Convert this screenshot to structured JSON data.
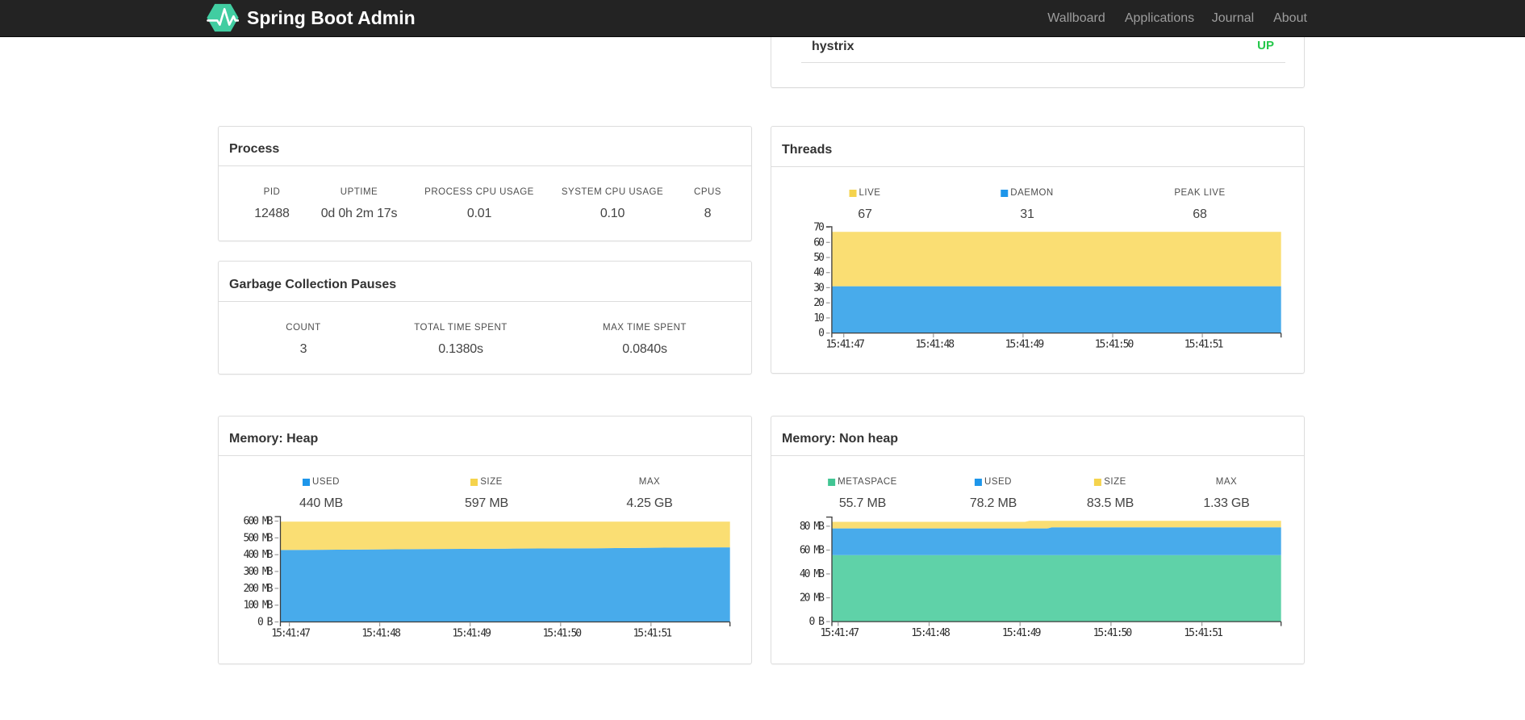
{
  "navbar": {
    "brand": "Spring Boot Admin",
    "items": [
      {
        "label": "Wallboard"
      },
      {
        "label": "Applications"
      },
      {
        "label": "Journal"
      },
      {
        "label": "About"
      }
    ]
  },
  "health": {
    "name": "hystrix",
    "status": "UP",
    "status_color": "#24c74a"
  },
  "process": {
    "title": "Process",
    "metrics": [
      {
        "label": "PID",
        "value": "12488"
      },
      {
        "label": "UPTIME",
        "value": "0d 0h 2m 17s"
      },
      {
        "label": "PROCESS CPU USAGE",
        "value": "0.01"
      },
      {
        "label": "SYSTEM CPU USAGE",
        "value": "0.10"
      },
      {
        "label": "CPUS",
        "value": "8"
      }
    ]
  },
  "gc": {
    "title": "Garbage Collection Pauses",
    "metrics": [
      {
        "label": "COUNT",
        "value": "3"
      },
      {
        "label": "TOTAL TIME SPENT",
        "value": "0.1380s"
      },
      {
        "label": "MAX TIME SPENT",
        "value": "0.0840s"
      }
    ]
  },
  "threads": {
    "title": "Threads",
    "legend": [
      {
        "label": "LIVE",
        "value": "67",
        "swatch": "#f5d34d"
      },
      {
        "label": "DAEMON",
        "value": "31",
        "swatch": "#1e96ea"
      },
      {
        "label": "PEAK LIVE",
        "value": "68"
      }
    ]
  },
  "heap": {
    "title": "Memory: Heap",
    "legend": [
      {
        "label": "USED",
        "value": "440 MB",
        "swatch": "#1e96ea"
      },
      {
        "label": "SIZE",
        "value": "597 MB",
        "swatch": "#f5d34d"
      },
      {
        "label": "MAX",
        "value": "4.25 GB"
      }
    ]
  },
  "nonheap": {
    "title": "Memory: Non heap",
    "legend": [
      {
        "label": "METASPACE",
        "value": "55.7 MB",
        "swatch": "#41c593"
      },
      {
        "label": "USED",
        "value": "78.2 MB",
        "swatch": "#1e96ea"
      },
      {
        "label": "SIZE",
        "value": "83.5 MB",
        "swatch": "#f5d34d"
      },
      {
        "label": "MAX",
        "value": "1.33 GB"
      }
    ]
  },
  "chart_data": [
    {
      "id": "threads",
      "type": "area",
      "stacked": true,
      "title": "Threads",
      "x_labels": [
        "15:41:47",
        "15:41:48",
        "15:41:49",
        "15:41:50",
        "15:41:51"
      ],
      "ylim": [
        0,
        70.35
      ],
      "yticks": [
        {
          "v": 0,
          "label": "0"
        },
        {
          "v": 10,
          "label": "10"
        },
        {
          "v": 20,
          "label": "20"
        },
        {
          "v": 30,
          "label": "30"
        },
        {
          "v": 40,
          "label": "40"
        },
        {
          "v": 50,
          "label": "50"
        },
        {
          "v": 60,
          "label": "60"
        },
        {
          "v": 70,
          "label": "70"
        }
      ],
      "series": [
        {
          "name": "DAEMON",
          "color": "#48abeb",
          "points": [
            [
              0,
              31
            ],
            [
              1,
              31
            ]
          ]
        },
        {
          "name": "LIVE",
          "color": "#fade73",
          "points": [
            [
              0,
              67
            ],
            [
              1,
              67
            ]
          ]
        }
      ]
    },
    {
      "id": "heap",
      "type": "area",
      "stacked": true,
      "title": "Memory: Heap (MB)",
      "x_labels": [
        "15:41:47",
        "15:41:48",
        "15:41:49",
        "15:41:50",
        "15:41:51"
      ],
      "ylim": [
        0,
        626.85
      ],
      "yticks": [
        {
          "v": 0,
          "label": "0 B"
        },
        {
          "v": 100,
          "label": "100 MB"
        },
        {
          "v": 200,
          "label": "200 MB"
        },
        {
          "v": 300,
          "label": "300 MB"
        },
        {
          "v": 400,
          "label": "400 MB"
        },
        {
          "v": 500,
          "label": "500 MB"
        },
        {
          "v": 600,
          "label": "600 MB"
        }
      ],
      "series": [
        {
          "name": "USED",
          "color": "#48abeb",
          "points": [
            [
              0,
              428
            ],
            [
              0.16,
              430.5
            ],
            [
              0.31,
              433.5
            ],
            [
              0.5,
              436
            ],
            [
              0.7,
              438.5
            ],
            [
              0.91,
              443
            ],
            [
              1,
              444
            ]
          ]
        },
        {
          "name": "SIZE",
          "color": "#fade73",
          "points": [
            [
              0,
              597
            ],
            [
              1,
              597
            ]
          ]
        }
      ]
    },
    {
      "id": "nonheap",
      "type": "area",
      "stacked": true,
      "title": "Memory: Non heap (MB)",
      "x_labels": [
        "15:41:47",
        "15:41:48",
        "15:41:49",
        "15:41:50",
        "15:41:51"
      ],
      "ylim": [
        0,
        87.675
      ],
      "yticks": [
        {
          "v": 0,
          "label": "0 B"
        },
        {
          "v": 20,
          "label": "20 MB"
        },
        {
          "v": 40,
          "label": "40 MB"
        },
        {
          "v": 60,
          "label": "60 MB"
        },
        {
          "v": 80,
          "label": "80 MB"
        }
      ],
      "series": [
        {
          "name": "METASPACE",
          "color": "#5fd2a8",
          "points": [
            [
              0,
              55.7
            ],
            [
              1,
              55.7
            ]
          ]
        },
        {
          "name": "USED",
          "color": "#48abeb",
          "points": [
            [
              0,
              78.2
            ],
            [
              0.48,
              78.2
            ],
            [
              0.49,
              79.1
            ],
            [
              1,
              79.1
            ]
          ]
        },
        {
          "name": "SIZE",
          "color": "#fade73",
          "points": [
            [
              0,
              83.7
            ],
            [
              0.43,
              83.7
            ],
            [
              0.44,
              84.5
            ],
            [
              1,
              84.5
            ]
          ]
        }
      ]
    }
  ]
}
